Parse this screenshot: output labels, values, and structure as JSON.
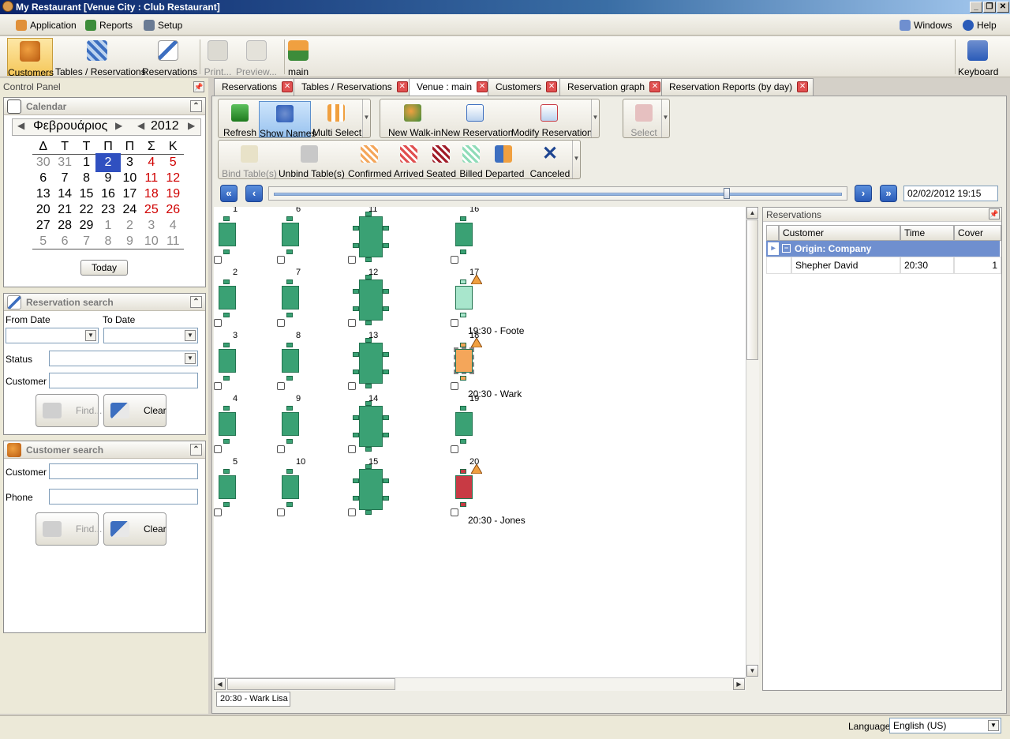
{
  "window": {
    "title": "My Restaurant [Venue City : Club Restaurant]"
  },
  "menubar": {
    "application": "Application",
    "reports": "Reports",
    "setup": "Setup",
    "windows": "Windows",
    "help": "Help"
  },
  "ribbon": {
    "customers": "Customers",
    "tables_reservations": "Tables / Reservations",
    "reservations": "Reservations",
    "print": "Print...",
    "preview": "Preview...",
    "main": "main",
    "keyboard": "Keyboard"
  },
  "control_panel": {
    "title": "Control Panel"
  },
  "calendar": {
    "title": "Calendar",
    "month": "Φεβρουάριος",
    "year": "2012",
    "weekdays": [
      "Δ",
      "Τ",
      "Τ",
      "Π",
      "Π",
      "Σ",
      "Κ"
    ],
    "weeks": [
      [
        "30",
        "31",
        "1",
        "2",
        "3",
        "4",
        "5"
      ],
      [
        "6",
        "7",
        "8",
        "9",
        "10",
        "11",
        "12"
      ],
      [
        "13",
        "14",
        "15",
        "16",
        "17",
        "18",
        "19"
      ],
      [
        "20",
        "21",
        "22",
        "23",
        "24",
        "25",
        "26"
      ],
      [
        "27",
        "28",
        "29",
        "1",
        "2",
        "3",
        "4"
      ],
      [
        "5",
        "6",
        "7",
        "8",
        "9",
        "10",
        "11"
      ]
    ],
    "selected_day": "2",
    "today_button": "Today"
  },
  "reservation_search": {
    "title": "Reservation search",
    "from_date": "From Date",
    "to_date": "To Date",
    "status": "Status",
    "customer": "Customer",
    "find": "Find...",
    "clear": "Clear"
  },
  "customer_search": {
    "title": "Customer search",
    "customer": "Customer",
    "phone": "Phone",
    "find": "Find...",
    "clear": "Clear"
  },
  "tabs": [
    "Reservations",
    "Tables / Reservations",
    "Venue : main",
    "Customers",
    "Reservation graph",
    "Reservation Reports (by day)"
  ],
  "toolbar": {
    "refresh": "Refresh",
    "show_names": "Show Names",
    "multi_select": "Multi Select",
    "new_walkin": "New Walk-in",
    "new_reservation": "New Reservation",
    "modify_reservation": "Modify Reservation",
    "select": "Select",
    "bind_tables": "Bind Table(s)",
    "unbind_tables": "Unbind Table(s)",
    "confirmed": "Confirmed",
    "arrived": "Arrived",
    "seated": "Seated",
    "billed": "Billed",
    "departed": "Departed",
    "canceled": "Canceled"
  },
  "timeline": {
    "datetime": "02/02/2012 19:15",
    "position_fraction": 0.8
  },
  "venue": {
    "tables": [
      "1",
      "2",
      "3",
      "4",
      "5",
      "6",
      "7",
      "8",
      "9",
      "10",
      "11",
      "12",
      "13",
      "14",
      "15",
      "16",
      "17",
      "18",
      "19",
      "20"
    ],
    "labels": {
      "t17": "19:30 - Foote",
      "t18": "20:30 - Wark",
      "t20": "20:30 - Jones"
    },
    "status_colors": {
      "free": "#3aa174",
      "pending": "#a8e6cc",
      "selected": "#f4a65a",
      "occupied": "#c83a44"
    }
  },
  "status_line": "20:30 - Wark Lisa",
  "reservations_panel": {
    "title": "Reservations",
    "columns": [
      "Customer",
      "Time",
      "Cover"
    ],
    "group": "Origin: Company",
    "rows": [
      {
        "customer": "Shepher David",
        "time": "20:30",
        "cover": "1"
      }
    ]
  },
  "bottom": {
    "language_label": "Language",
    "language_value": "English (US)"
  }
}
